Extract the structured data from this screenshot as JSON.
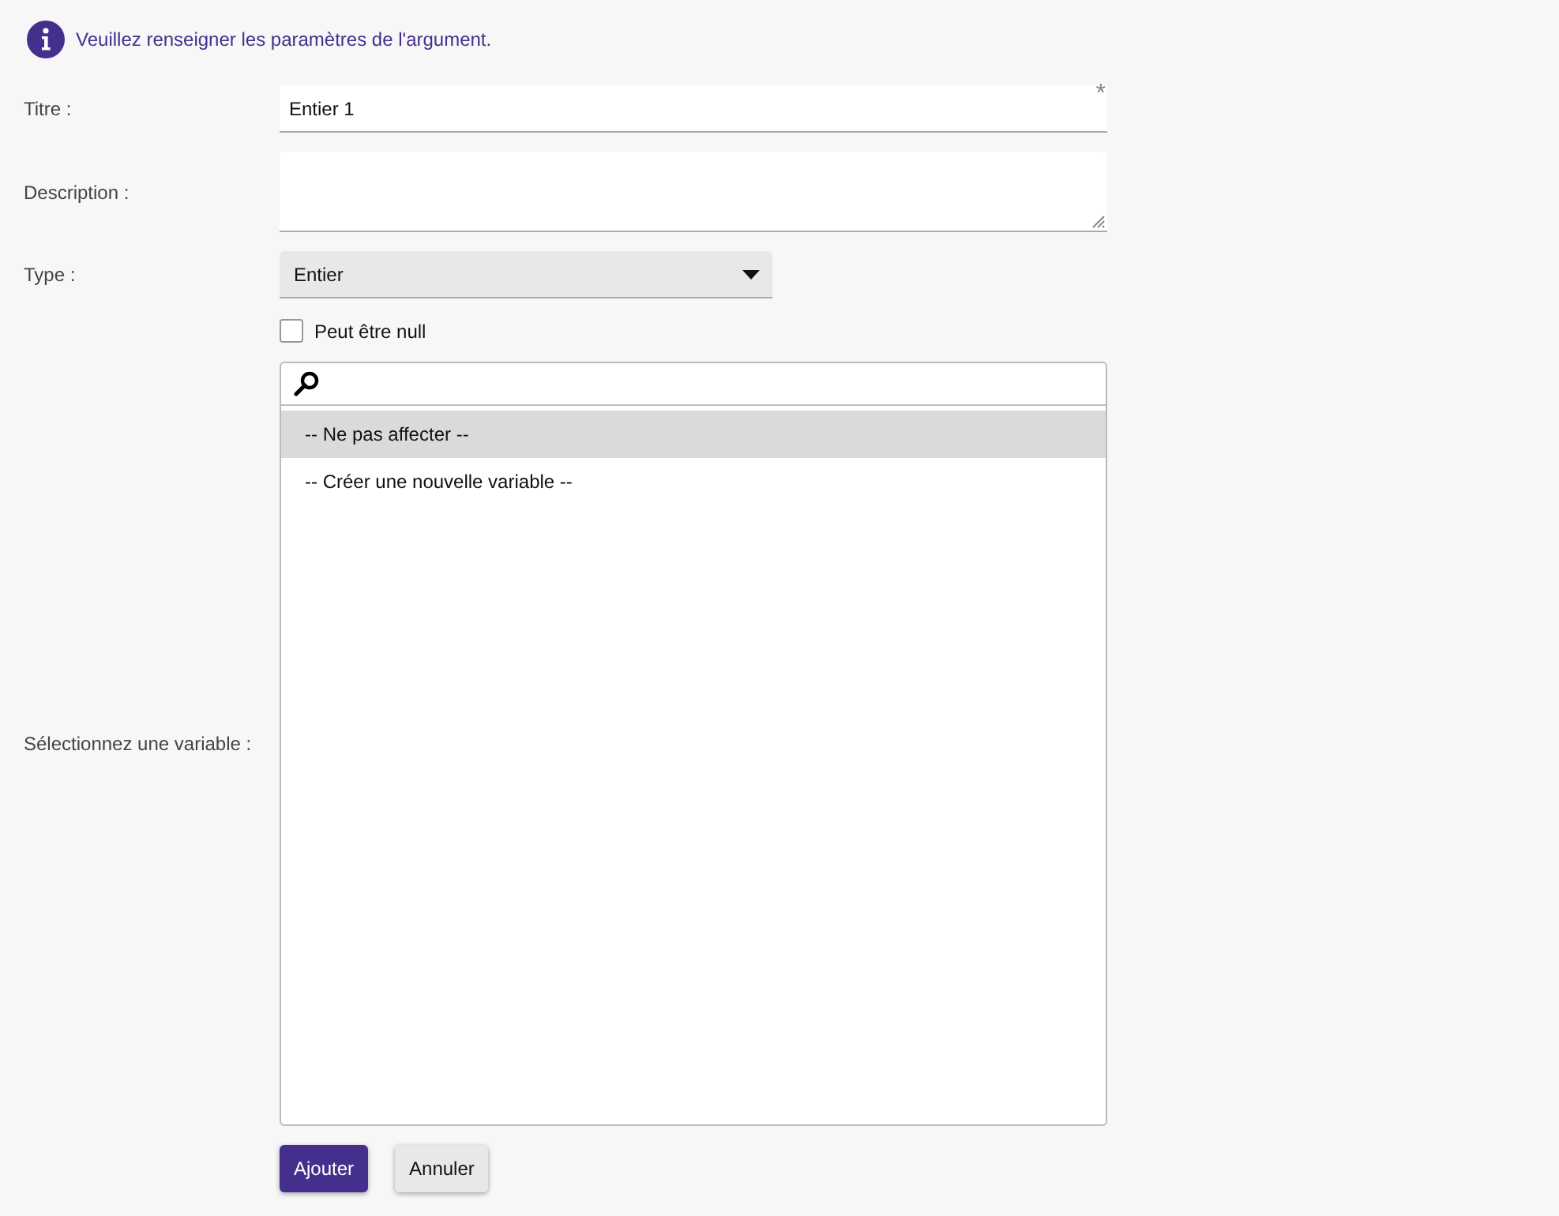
{
  "notice": "Veuillez renseigner les paramètres de l'argument.",
  "title_field": {
    "label": "Titre :",
    "value": "Entier 1",
    "required_mark": "*"
  },
  "description_field": {
    "label": "Description :"
  },
  "type_field": {
    "label": "Type :",
    "value": "Entier"
  },
  "nullable": {
    "label": "Peut être null",
    "checked": false
  },
  "variable_field": {
    "label": "Sélectionnez une variable :",
    "options": [
      {
        "label": "-- Ne pas affecter --",
        "selected": true
      },
      {
        "label": "-- Créer une nouvelle variable --",
        "selected": false
      }
    ]
  },
  "buttons": [
    {
      "label": "Ajouter",
      "kind": "primary"
    },
    {
      "label": "Annuler",
      "kind": "secondary"
    }
  ]
}
